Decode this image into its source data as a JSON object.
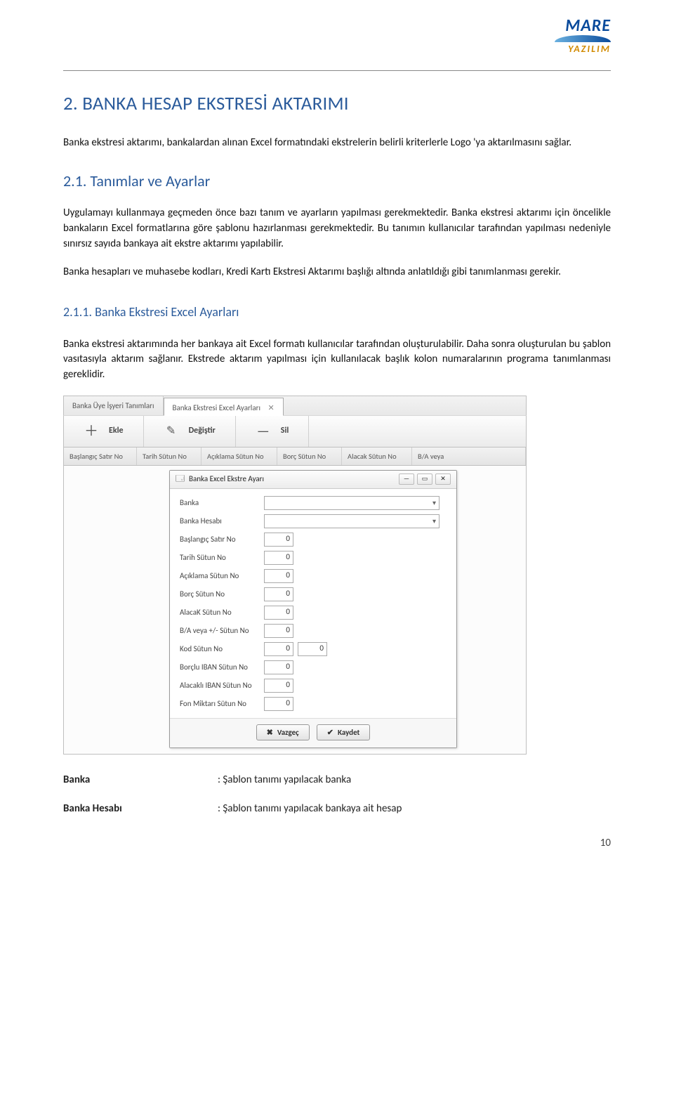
{
  "logo": {
    "brand": "MARE",
    "sub": "YAZILIM"
  },
  "h1": "2. BANKA HESAP EKSTRESİ AKTARIMI",
  "p1": "Banka ekstresi aktarımı, bankalardan alınan Excel formatındaki ekstrelerin belirli kriterlerle Logo 'ya aktarılmasını sağlar.",
  "h2": "2.1.  Tanımlar ve Ayarlar",
  "p2": "Uygulamayı kullanmaya geçmeden önce bazı tanım ve ayarların yapılması gerekmektedir. Banka ekstresi aktarımı için öncelikle bankaların Excel formatlarına göre şablonu hazırlanması gerekmektedir. Bu tanımın kullanıcılar tarafından yapılması nedeniyle sınırsız sayıda bankaya ait ekstre aktarımı yapılabilir.",
  "p3": "Banka hesapları ve muhasebe kodları, Kredi Kartı Ekstresi Aktarımı başlığı altında anlatıldığı gibi tanımlanması gerekir.",
  "h3": "2.1.1.  Banka Ekstresi Excel Ayarları",
  "p4": "Banka ekstresi aktarımında her bankaya ait Excel formatı kullanıcılar tarafından oluşturulabilir. Daha sonra oluşturulan bu şablon vasıtasıyla aktarım sağlanır. Ekstrede aktarım yapılması için kullanılacak başlık kolon numaralarının programa tanımlanması gereklidir.",
  "ui": {
    "tabs": [
      {
        "label": "Banka Üye İşyeri Tanımları"
      },
      {
        "label": "Banka Ekstresi Excel Ayarları"
      }
    ],
    "toolbar": {
      "ekle": "Ekle",
      "degistir": "Değiştir",
      "sil": "Sil"
    },
    "cols": [
      "Başlangıç Satır No",
      "Tarih Sütun No",
      "Açıklama Sütun No",
      "Borç Sütun No",
      "Alacak Sütun No",
      "B/A veya"
    ],
    "dlg_title": "Banka Excel Ekstre Ayarı",
    "fields": {
      "banka": "Banka",
      "banka_hesabi": "Banka Hesabı",
      "baslangic": "Başlangıç Satır No",
      "tarih": "Tarih Sütun No",
      "aciklama": "Açıklama Sütun No",
      "borc": "Borç Sütun No",
      "alacak": "AlacaK Sütun No",
      "ba": "B/A veya  +/- Sütun No",
      "kod": "Kod Sütun No",
      "borclu_iban": "Borçlu IBAN Sütun No",
      "alacakli_iban": "Alacaklı IBAN Sütun No",
      "fon": "Fon Miktarı Sütun No"
    },
    "values": {
      "baslangic": "0",
      "tarih": "0",
      "aciklama": "0",
      "borc": "0",
      "alacak": "0",
      "ba": "0",
      "kod1": "0",
      "kod2": "0",
      "borclu_iban": "0",
      "alacakli_iban": "0",
      "fon": "0"
    },
    "btn_vazgec": "Vazgeç",
    "btn_kaydet": "Kaydet"
  },
  "defs": [
    {
      "label": "Banka",
      "value": ": Şablon tanımı yapılacak banka"
    },
    {
      "label": "Banka Hesabı",
      "value": ": Şablon tanımı yapılacak bankaya ait hesap"
    }
  ],
  "pagenum": "10"
}
